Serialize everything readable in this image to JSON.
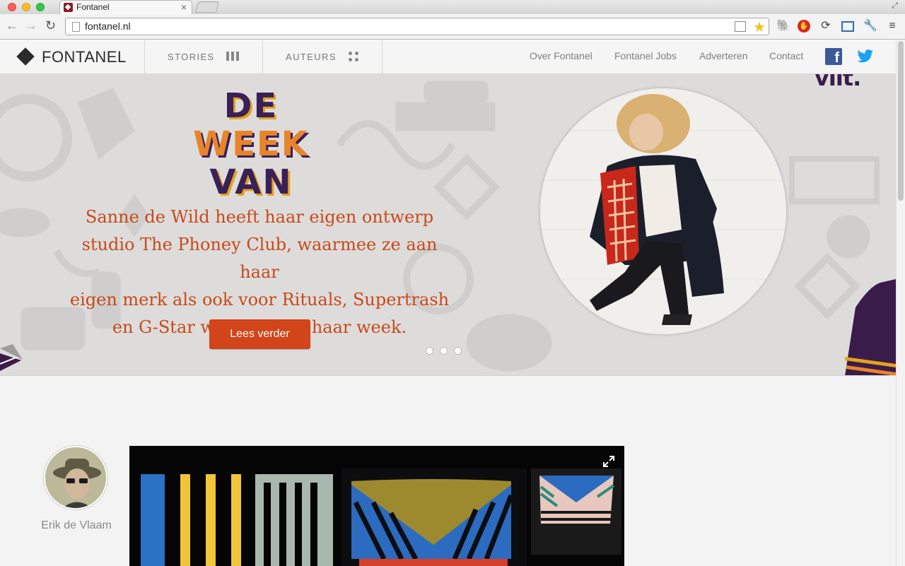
{
  "browser": {
    "tab_title": "Fontanel",
    "tab_close": "×",
    "url": "fontanel.nl"
  },
  "header": {
    "logo": "FONTANEL",
    "nav": [
      {
        "label": "STORIES",
        "icon": "bars-icon"
      },
      {
        "label": "AUTEURS",
        "icon": "grid-dots-icon"
      }
    ],
    "links": [
      "Over Fontanel",
      "Fontanel Jobs",
      "Adverteren",
      "Contact"
    ],
    "social": [
      "facebook-icon",
      "twitter-icon"
    ]
  },
  "hero": {
    "title_lines": [
      "DE",
      "WEEK",
      "VAN"
    ],
    "text_lines": [
      "Sanne de Wild heeft haar eigen ontwerp",
      "studio The Phoney Club, waarmee ze aan haar",
      "eigen merk als ook voor Rituals, Supertrash",
      "en G-Star werkt. Dit is haar week."
    ],
    "button": "Lees verder",
    "slides": 3,
    "corner_logo": "vilt."
  },
  "story": {
    "author": "Erik de Vlaam"
  },
  "colors": {
    "accent": "#d2441a",
    "hero_text": "#c8491a",
    "purple": "#3a2058",
    "hero_bg": "#dddcdb"
  }
}
